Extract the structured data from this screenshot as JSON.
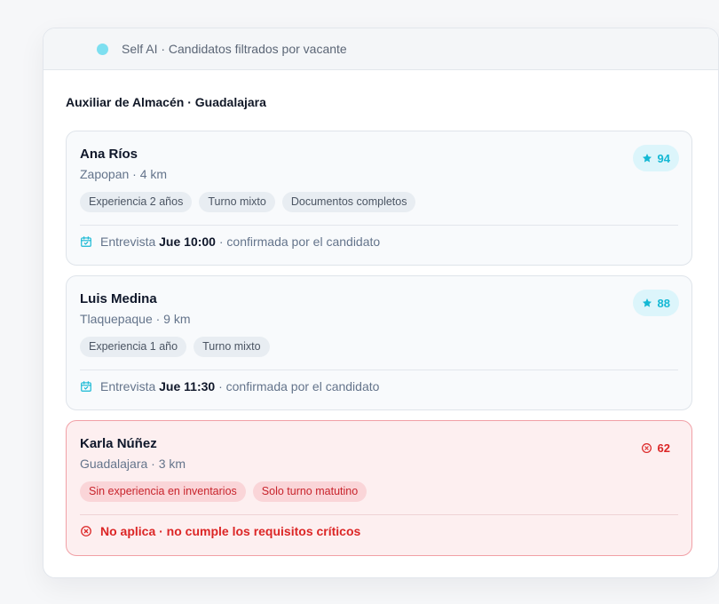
{
  "header": {
    "text": "Self AI · Candidatos filtrados por vacante"
  },
  "vacancy_title": "Auxiliar de Almacén · Guadalajara",
  "candidates": [
    {
      "name": "Ana Ríos",
      "location": "Zapopan · 4 km",
      "score": "94",
      "status": "accepted",
      "tags": [
        "Experiencia 2 años",
        "Turno mixto",
        "Documentos completos"
      ],
      "interview_prefix": "Entrevista",
      "interview_time": "Jue 10:00",
      "interview_suffix": "· confirmada por el candidato"
    },
    {
      "name": "Luis Medina",
      "location": "Tlaquepaque · 9 km",
      "score": "88",
      "status": "accepted",
      "tags": [
        "Experiencia 1 año",
        "Turno mixto"
      ],
      "interview_prefix": "Entrevista",
      "interview_time": "Jue 11:30",
      "interview_suffix": "· confirmada por el candidato"
    },
    {
      "name": "Karla Núñez",
      "location": "Guadalajara · 3 km",
      "score": "62",
      "status": "rejected",
      "tags": [
        "Sin experiencia en inventarios",
        "Solo turno matutino"
      ],
      "reject_message": "No aplica · no cumple los requisitos críticos"
    }
  ],
  "colors": {
    "accent": "#14b8d4",
    "accent_bg": "#dcf5fb",
    "danger": "#dc2626",
    "danger_bg": "#fdeff0",
    "status_dot": "#7ddff0"
  },
  "icons": {
    "score_good": "star-icon",
    "score_bad": "x-circle-icon",
    "interview": "calendar-check-icon",
    "reject": "x-circle-icon"
  }
}
